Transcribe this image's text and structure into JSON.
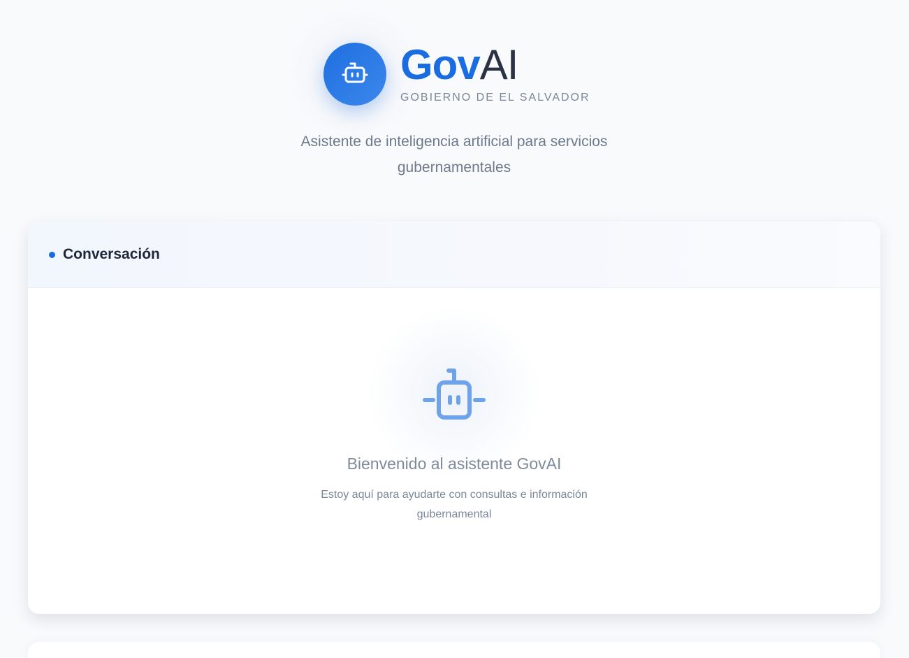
{
  "header": {
    "brand_part1": "Gov",
    "brand_part2": "AI",
    "subtitle": "GOBIERNO DE EL SALVADOR",
    "tagline": "Asistente de inteligencia artificial para servicios gubernamentales",
    "logo_icon": "robot-icon"
  },
  "chat": {
    "title": "Conversación",
    "empty_state": {
      "icon": "robot-icon",
      "title": "Bienvenido al asistente GovAI",
      "text": "Estoy aquí para ayudarte con consultas e información gubernamental"
    }
  },
  "colors": {
    "primary": "#1a6de0",
    "text_dark": "#1e2638",
    "text_muted": "#7a8799",
    "background": "#f9fafc"
  }
}
